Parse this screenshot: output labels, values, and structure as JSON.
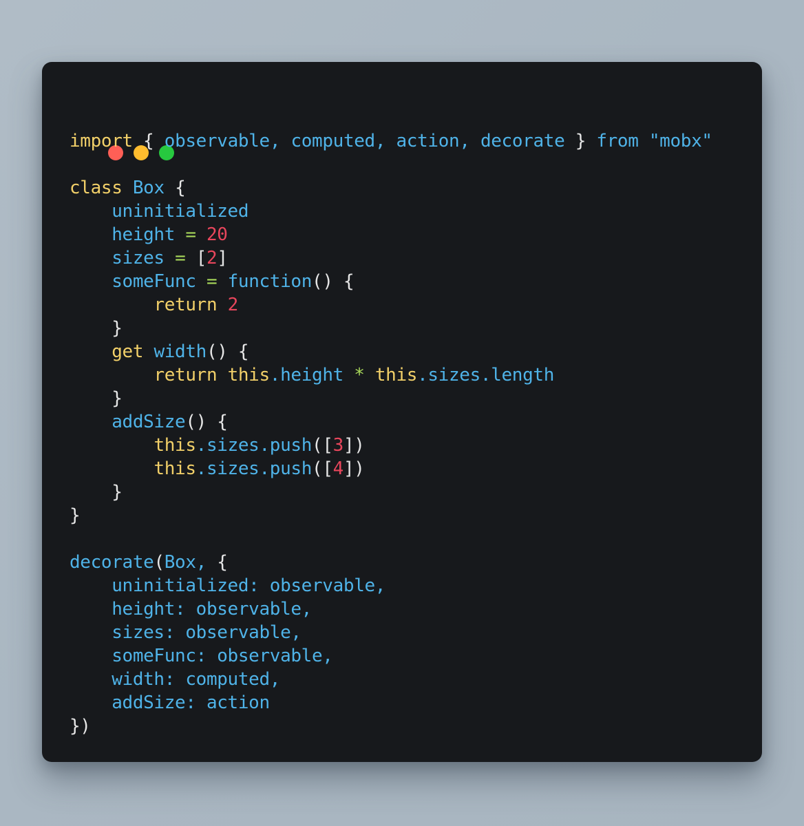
{
  "window": {
    "name": "code-snippet-window",
    "background_color": "#17191c",
    "page_background_color": "#aab7c2",
    "traffic_lights": [
      {
        "name": "close",
        "label": "Close",
        "color": "#ff5f56"
      },
      {
        "name": "minimize",
        "label": "Minimize",
        "color": "#ffbd2e"
      },
      {
        "name": "zoom",
        "label": "Zoom",
        "color": "#27c93f"
      }
    ]
  },
  "syntax_colors": {
    "keyword": "#f2d069",
    "identifier": "#4fb3e8",
    "number": "#e8465c",
    "operator": "#a9d95a",
    "punctuation": "#e6e6e6",
    "text": "#e6e6e6"
  },
  "code": {
    "language": "javascript",
    "text": "import { observable, computed, action, decorate } from \"mobx\"\n\nclass Box {\n    uninitialized\n    height = 20\n    sizes = [2]\n    someFunc = function() {\n        return 2\n    }\n    get width() {\n        return this.height * this.sizes.length\n    }\n    addSize() {\n        this.sizes.push([3])\n        this.sizes.push([4])\n    }\n}\n\ndecorate(Box, {\n    uninitialized: observable,\n    height: observable,\n    sizes: observable,\n    someFunc: observable,\n    width: computed,\n    addSize: action\n})",
    "lines": [
      "import { observable, computed, action, decorate } from \"mobx\"",
      "",
      "class Box {",
      "    uninitialized",
      "    height = 20",
      "    sizes = [2]",
      "    someFunc = function() {",
      "        return 2",
      "    }",
      "    get width() {",
      "        return this.height * this.sizes.length",
      "    }",
      "    addSize() {",
      "        this.sizes.push([3])",
      "        this.sizes.push([4])",
      "    }",
      "}",
      "",
      "decorate(Box, {",
      "    uninitialized: observable,",
      "    height: observable,",
      "    sizes: observable,",
      "    someFunc: observable,",
      "    width: computed,",
      "    addSize: action",
      "})"
    ]
  }
}
